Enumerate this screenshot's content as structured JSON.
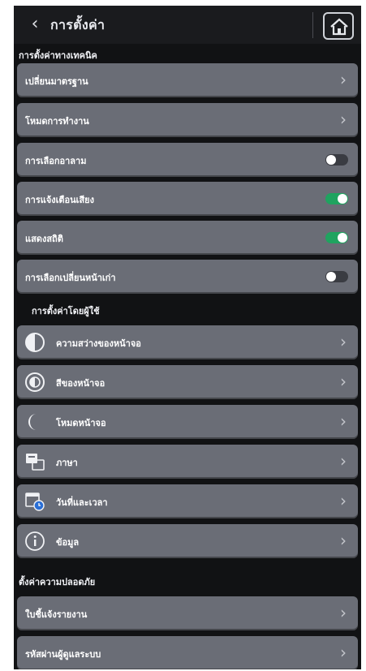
{
  "header": {
    "title": "การตั้งค่า"
  },
  "sections": {
    "s1": "การตั้งค่าทางเทคนิค",
    "s2": "การตั้งค่าโดยผู้ใช้",
    "s3": "ตั้งค่าความปลอดภัย"
  },
  "rows": {
    "r1": "เปลี่ยนมาตรฐาน",
    "r2": "โหมดการทำงาน",
    "r3": "การเลือกอาลาม",
    "r4": "การแจ้งเตือนเสียง",
    "r5": "แสดงสถิติ",
    "r6": "การเลือกเปลี่ยนหน้าเก่า",
    "r7": "ความสว่างของหน้าจอ",
    "r8": "สีของหน้าจอ",
    "r9": "โหมดหน้าจอ",
    "r10": "ภาษา",
    "r11": "วันที่และเวลา",
    "r12": "ข้อมูล",
    "r13": "ใบชี้แจ้งรายงาน",
    "r14": "รหัสผ่านผู้ดูแลระบบ"
  },
  "toggles": {
    "r3": false,
    "r4": true,
    "r5": true,
    "r6": false
  },
  "colors": {
    "on": "#1fa35f",
    "off": "#3a3c42",
    "row": "#6a6d76",
    "background": "#111214"
  },
  "icons": {
    "back": "chevron-left-icon",
    "home": "home-icon",
    "brightness": "half-circle-icon",
    "color": "palette-icon",
    "mode": "moon-icon",
    "language": "language-icon",
    "datetime": "calendar-clock-icon",
    "info": "info-icon"
  }
}
